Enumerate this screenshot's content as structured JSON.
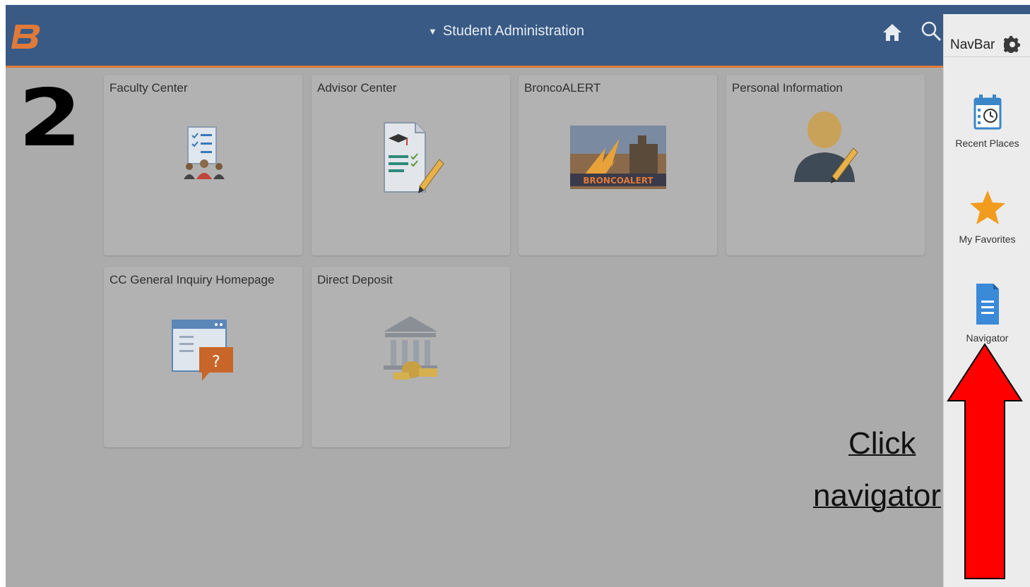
{
  "header": {
    "title": "Student Administration",
    "logo_letter": "B",
    "colors": {
      "bar": "#385a85",
      "accent": "#e07a3a"
    }
  },
  "tiles": [
    {
      "label": "Faculty Center",
      "icon": "faculty-center-icon"
    },
    {
      "label": "Advisor Center",
      "icon": "advisor-center-icon"
    },
    {
      "label": "BroncoALERT",
      "icon": "broncoalert-image",
      "image_text": "BRONCOALERT"
    },
    {
      "label": "Personal Information",
      "icon": "person-edit-icon"
    },
    {
      "label": "CC General Inquiry Homepage",
      "icon": "inquiry-help-icon"
    },
    {
      "label": "Direct Deposit",
      "icon": "bank-deposit-icon"
    }
  ],
  "navbar": {
    "title": "NavBar",
    "items": [
      {
        "label": "Recent Places",
        "icon": "calendar-clock-icon"
      },
      {
        "label": "My Favorites",
        "icon": "star-icon"
      },
      {
        "label": "Navigator",
        "icon": "document-icon"
      }
    ]
  },
  "annotations": {
    "step_number": "2",
    "instruction_line1": "Click",
    "instruction_line2": "navigator",
    "arrow_color": "#ff0000"
  }
}
